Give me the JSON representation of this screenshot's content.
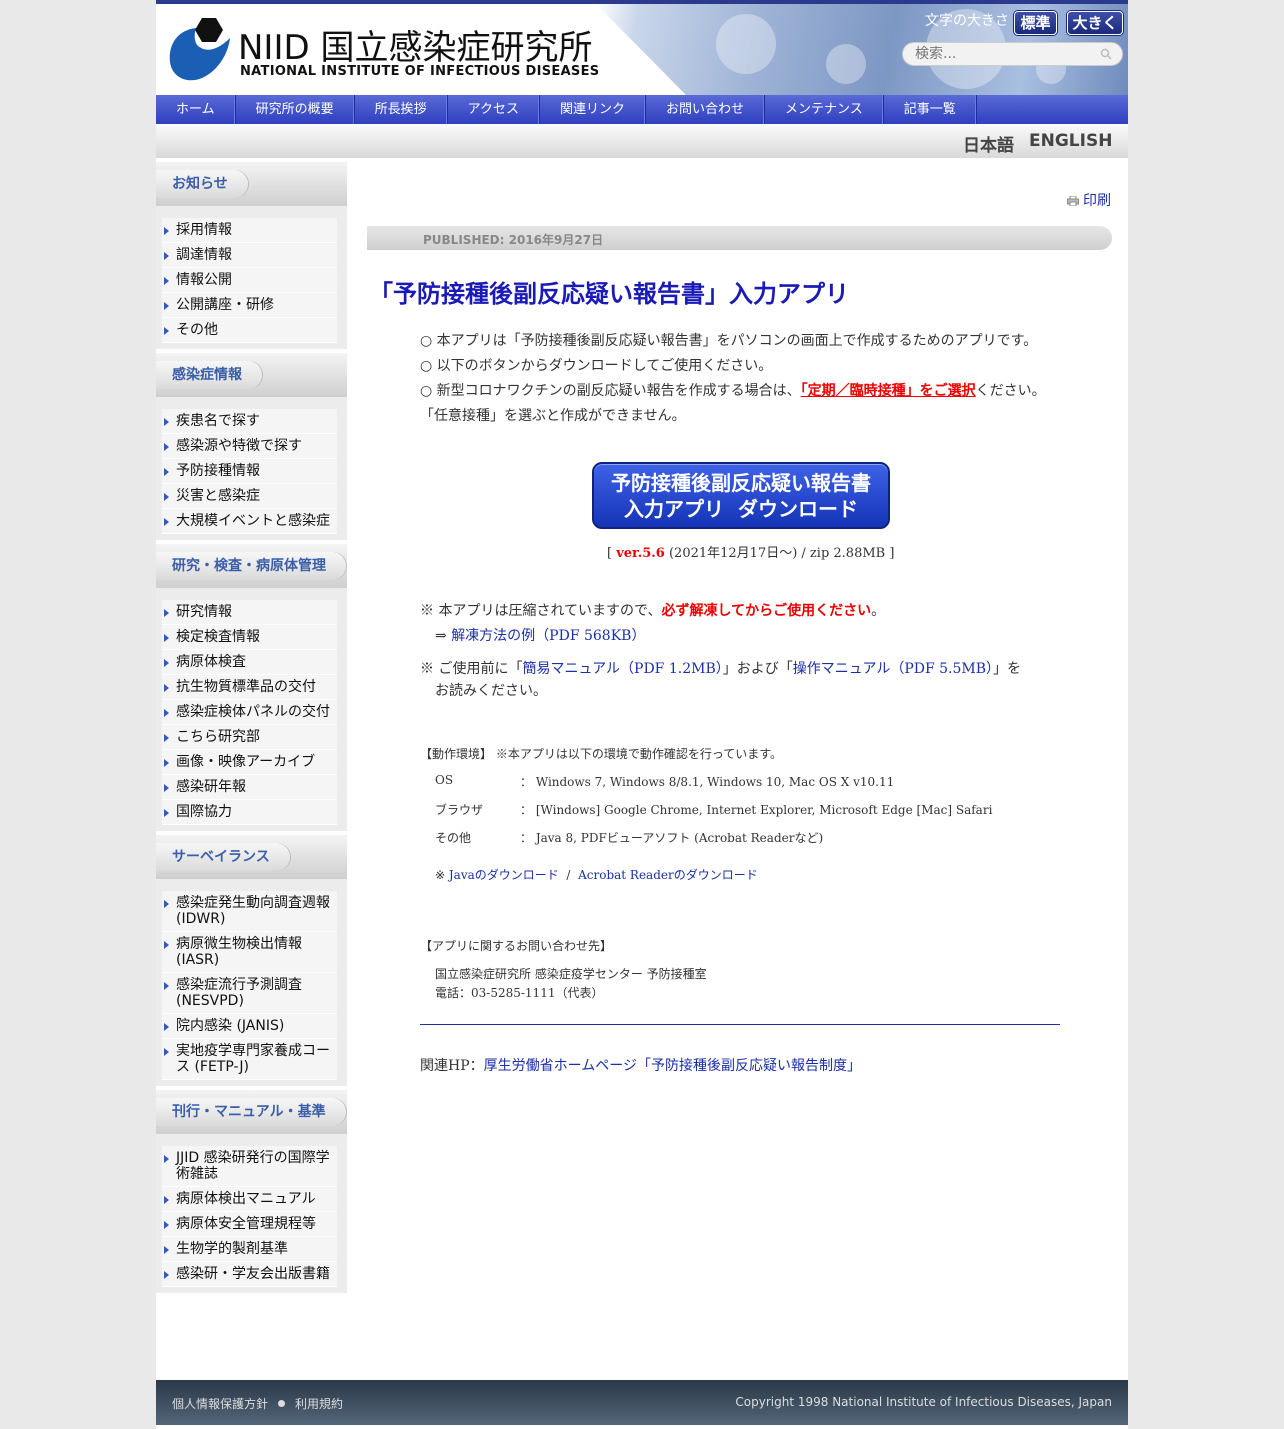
{
  "header": {
    "logo_main": "NIID 国立感染症研究所",
    "logo_sub": "NATIONAL INSTITUTE OF INFECTIOUS DISEASES",
    "font_size_label": "文字の大きさ",
    "font_size_standard": "標準",
    "font_size_large": "大きく",
    "search_placeholder": "検索..."
  },
  "nav": [
    "ホーム",
    "研究所の概要",
    "所長挨拶",
    "アクセス",
    "関連リンク",
    "お問い合わせ",
    "メンテナンス",
    "記事一覧"
  ],
  "lang": {
    "ja": "日本語",
    "en": "ENGLISH"
  },
  "sidebar": [
    {
      "title": "お知らせ",
      "items": [
        "採用情報",
        "調達情報",
        "情報公開",
        "公開講座・研修",
        "その他"
      ]
    },
    {
      "title": "感染症情報",
      "items": [
        "疾患名で探す",
        "感染源や特徴で探す",
        "予防接種情報",
        "災害と感染症",
        "大規模イベントと感染症"
      ]
    },
    {
      "title": "研究・検査・病原体管理",
      "items": [
        "研究情報",
        "検定検査情報",
        "病原体検査",
        "抗生物質標準品の交付",
        "感染症検体パネルの交付",
        "こちら研究部",
        "画像・映像アーカイブ",
        "感染研年報",
        "国際協力"
      ]
    },
    {
      "title": "サーベイランス",
      "items": [
        "感染症発生動向調査週報 (IDWR)",
        "病原微生物検出情報 (IASR)",
        "感染症流行予測調査 (NESVPD)",
        "院内感染 (JANIS)",
        "実地疫学専門家養成コース (FETP-J)"
      ]
    },
    {
      "title": "刊行・マニュアル・基準",
      "items": [
        "JJID 感染研発行の国際学術雑誌",
        "病原体検出マニュアル",
        "病原体安全管理規程等",
        "生物学的製剤基準",
        "感染研・学友会出版書籍"
      ]
    }
  ],
  "main": {
    "print": "印刷",
    "published": "PUBLISHED: 2016年9月27日",
    "title": "「予防接種後副反応疑い報告書」入力アプリ",
    "line1": "○ 本アプリは「予防接種後副反応疑い報告書」をパソコンの画面上で作成するためのアプリです。",
    "line2": "○ 以下のボタンからダウンロードしてご使用ください。",
    "line3_a": "○ 新型コロナワクチンの副反応疑い報告を作成する場合は、",
    "line3_b": "「定期／臨時接種」をご選択",
    "line3_c": "ください。",
    "line4": "「任意接種」を選ぶと作成ができません。",
    "button_line1": "予防接種後副反応疑い報告書",
    "button_line2": "入力アプリ  ダウンロード",
    "version_a": "[ ",
    "version_b": "ver.5.6",
    "version_c": " (2021年12月17日～) / zip 2.88MB ]",
    "note1_a": "※ 本アプリは圧縮されていますので、",
    "note1_b": "必ず解凍してからご使用ください",
    "note1_c": "。",
    "note1_link_prefix": "⇒ ",
    "note1_link": "解凍方法の例（PDF 568KB）",
    "note2_a": "※ ご使用前に「",
    "note2_link1": "簡易マニュアル（PDF 1.2MB）",
    "note2_b": "」および「",
    "note2_link2": "操作マニュアル（PDF 5.5MB）",
    "note2_c": "」を",
    "note2_d": "お読みください。",
    "env_title": "【動作環境】 ※本アプリは以下の環境で動作確認を行っています。",
    "env": [
      {
        "label": "OS",
        "value": "： Windows 7, Windows 8/8.1, Windows 10, Mac OS X v10.11"
      },
      {
        "label": "ブラウザ",
        "value": "： [Windows] Google Chrome, Internet Explorer, Microsoft Edge  [Mac] Safari"
      },
      {
        "label": "その他",
        "value": "： Java 8, PDFビューアソフト (Acrobat Readerなど)"
      }
    ],
    "dl_prefix": "※ ",
    "dl_java": "Javaのダウンロード",
    "dl_sep": "  /  ",
    "dl_acrobat": "Acrobat Readerのダウンロード",
    "contact_title": "【アプリに関するお問い合わせ先】",
    "contact_org": "国立感染症研究所 感染症疫学センター 予防接種室",
    "contact_tel": "電話：03-5285-1111（代表）",
    "related_prefix": "関連HP：",
    "related_link": "厚生労働省ホームページ「予防接種後副反応疑い報告制度」"
  },
  "footer": {
    "privacy": "個人情報保護方針",
    "terms": "利用規約",
    "copyright": "Copyright 1998 National Institute of Infectious Diseases, Japan"
  }
}
